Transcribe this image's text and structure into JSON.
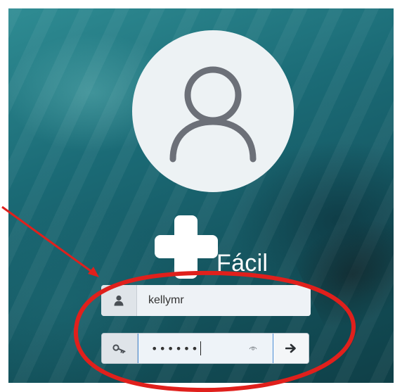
{
  "brand": {
    "text": "Fácil"
  },
  "login": {
    "username_value": "kellymr",
    "password_value": "••••••"
  },
  "icons": {
    "avatar": "user-outline-icon",
    "logo": "plus-logo-icon",
    "username": "user-icon",
    "password": "key-icon",
    "reveal": "eye-icon",
    "submit": "arrow-right-icon"
  },
  "colors": {
    "annotation": "#e0201c",
    "background": "#1b6b76",
    "field_background": "#e9eef3",
    "focus_border": "#4b8ed6"
  }
}
